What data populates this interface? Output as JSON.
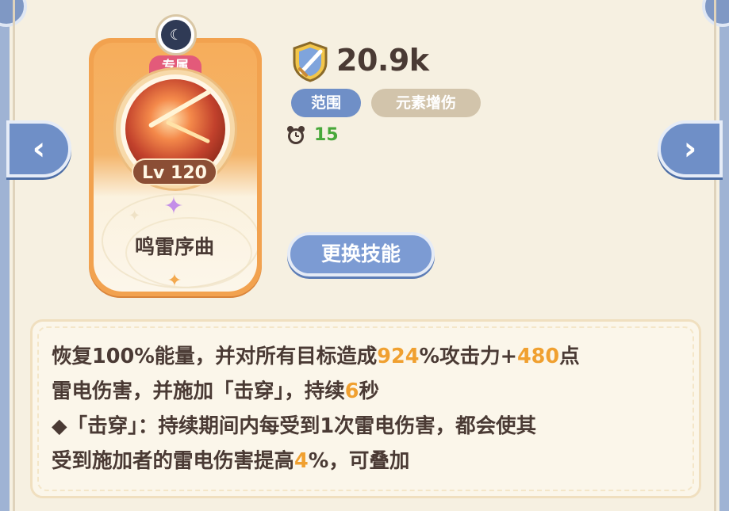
{
  "card": {
    "exclusive_label": "专属",
    "level_label": "Lv 120",
    "skill_name": "鸣雷序曲",
    "badge_icon": "moon-icon",
    "gem_icon": "four-point-star-icon"
  },
  "stats": {
    "power_icon": "shield-sword-icon",
    "power_value": "20.9k",
    "tags": [
      "范围",
      "元素增伤"
    ],
    "cooldown_icon": "alarm-clock-icon",
    "cooldown_value": "15"
  },
  "actions": {
    "change_skill_label": "更换技能"
  },
  "nav": {
    "prev_icon": "chevron-left-icon",
    "next_icon": "chevron-right-icon"
  },
  "description": {
    "line1": {
      "t1": "恢复100%能量，并对所有目标造成",
      "h1": "924",
      "t2": "%攻击力+",
      "h2": "480",
      "t3": "点"
    },
    "line2": {
      "t1": "雷电伤害，并施加「击穿」，持续",
      "h1": "6",
      "t2": "秒"
    },
    "line3": {
      "t1": "◆「击穿」：持续期间内每受到1次雷电伤害，都会使其"
    },
    "line4": {
      "t1": "受到施加者的雷电伤害提高",
      "h1": "4",
      "t2": "%，可叠加"
    }
  },
  "colors": {
    "accent_blue": "#6f8fc7",
    "highlight_orange": "#f0a030",
    "cooldown_green": "#48a83a",
    "card_orange": "#f2a24f"
  }
}
